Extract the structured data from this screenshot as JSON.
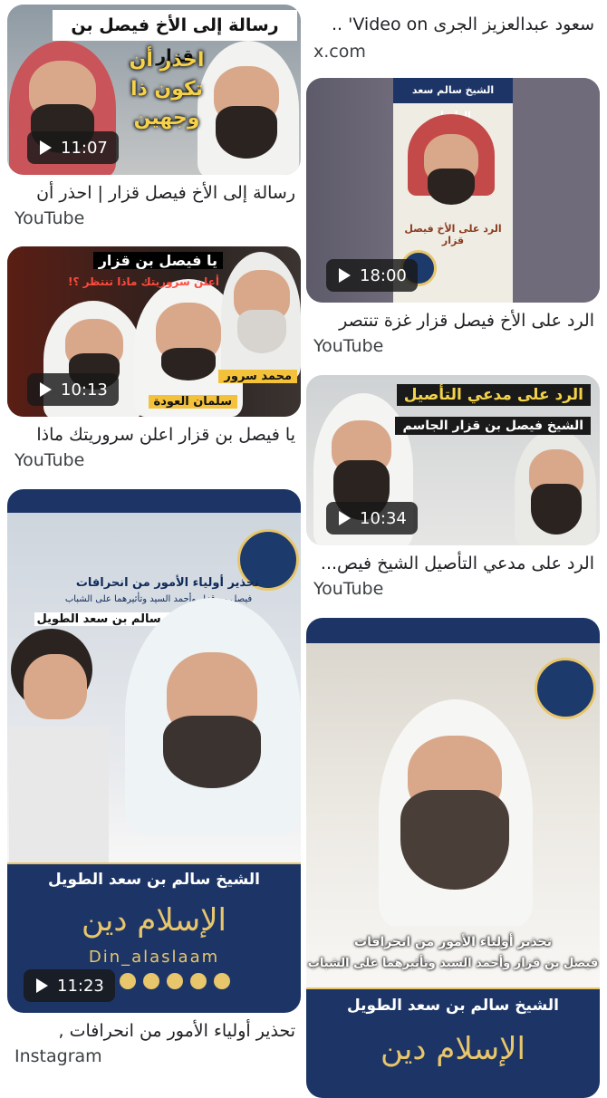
{
  "top_right": {
    "title": "سعود عبدالعزيز الجرى Video on' ..",
    "source": "x.com"
  },
  "cards": {
    "c1": {
      "headline": "رسالة إلى الأخ فيصل بن قزار",
      "overlay": "احذر أن تكون ذا وجهين",
      "duration": "11:07",
      "title": "رسالة إلى الأخ فيصل قزار | احذر أن",
      "source": "YouTube"
    },
    "c2": {
      "banner_top": "الشيخ سالم سعد الطويل",
      "subtitle": "الرد على الأخ فيصل قزار",
      "duration": "18:00",
      "title": "الرد على الأخ فيصل قزار غزة تنتصر",
      "source": "YouTube"
    },
    "c3": {
      "overlay_1": "يا فيصل بن قزار",
      "overlay_2": "أعلن سروريتك ماذا تنتظر ؟!",
      "name_1": "محمد سرور",
      "name_2": "سلمان العودة",
      "duration": "10:13",
      "title": "يا فيصل بن قزار اعلن سروريتك ماذا",
      "source": "YouTube"
    },
    "c4": {
      "overlay_1": "الرد على مدعي التأصيل",
      "overlay_2": "الشيخ فيصل بن قزار الجاسم",
      "duration": "10:34",
      "title": "الرد على مدعي التأصيل الشيخ فيص...",
      "source": "YouTube"
    },
    "c5": {
      "overlay_1": "تحذير أولياء الأمور من انحرافات",
      "overlay_2": "فيصل بن قزار وأحمد السيد وتأثيرهما على الشباب",
      "overlay_3": "لفضيلة الشيخ سالم بن سعد الطويل",
      "banner": "الشيخ سالم بن سعد الطويل",
      "logo_text": "الإسلام دين",
      "handle": "Din_alaslaam",
      "duration": "11:23",
      "title": "تحذير أولياء الأمور من انحرافات ,",
      "source": "Instagram"
    },
    "c6": {
      "overlay_1": "تحذير أولياء الأمور من انحرافات",
      "overlay_2": "فيصل بن قزار وأحمد السيد وتأثيرهما على الشباب",
      "banner": "الشيخ سالم بن سعد الطويل",
      "logo_text": "الإسلام دين"
    }
  },
  "colors": {
    "navy": "#1d3566",
    "gold": "#e8c66b"
  }
}
